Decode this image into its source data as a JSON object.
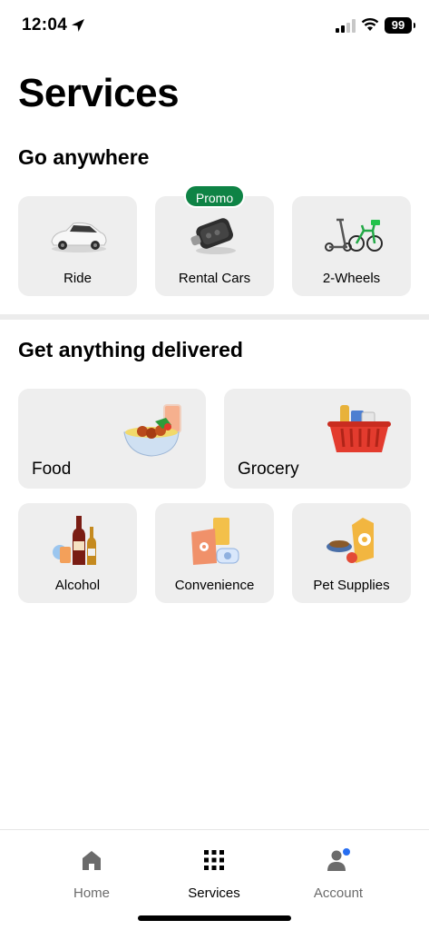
{
  "status_bar": {
    "time": "12:04",
    "battery": "99"
  },
  "page_title": "Services",
  "sections": {
    "go_anywhere": {
      "title": "Go anywhere",
      "items": [
        {
          "label": "Ride",
          "icon": "car-icon"
        },
        {
          "label": "Rental Cars",
          "icon": "car-key-icon",
          "badge": "Promo"
        },
        {
          "label": "2-Wheels",
          "icon": "scooter-bike-icon"
        }
      ]
    },
    "delivered": {
      "title": "Get anything delivered",
      "items": [
        {
          "label": "Food",
          "icon": "food-bowl-icon"
        },
        {
          "label": "Grocery",
          "icon": "grocery-basket-icon"
        },
        {
          "label": "Alcohol",
          "icon": "bottles-icon"
        },
        {
          "label": "Convenience",
          "icon": "convenience-bags-icon"
        },
        {
          "label": "Pet Supplies",
          "icon": "pet-supplies-icon"
        }
      ]
    }
  },
  "tab_bar": {
    "tabs": [
      {
        "label": "Home",
        "icon": "home-icon",
        "active": false
      },
      {
        "label": "Services",
        "icon": "grid-icon",
        "active": true
      },
      {
        "label": "Account",
        "icon": "person-icon",
        "active": false,
        "notification_dot": true
      }
    ]
  },
  "colors": {
    "promo": "#0e8345",
    "tile_bg": "#eeeeee",
    "notification": "#276ef1"
  }
}
